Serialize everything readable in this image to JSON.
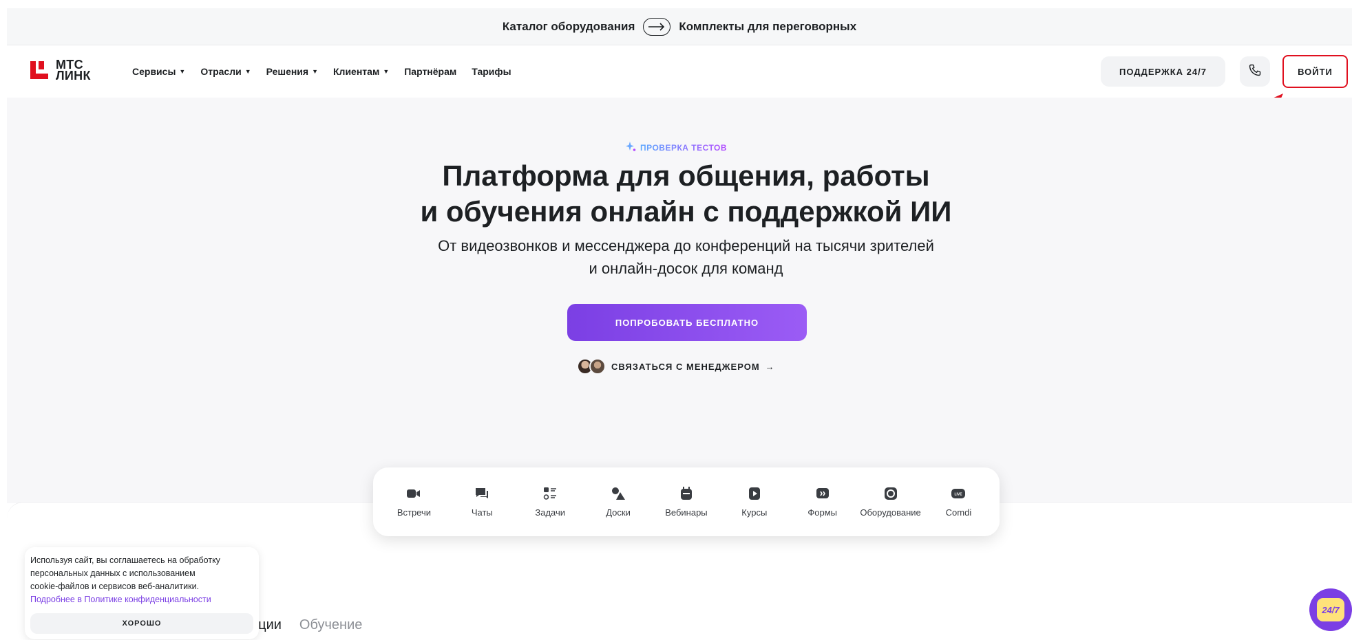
{
  "promo": {
    "left": "Каталог оборудования",
    "right": "Комплекты для переговорных"
  },
  "header": {
    "logo_line1": "МТС",
    "logo_line2": "ЛИНК",
    "nav": [
      {
        "label": "Сервисы",
        "dropdown": true
      },
      {
        "label": "Отрасли",
        "dropdown": true
      },
      {
        "label": "Решения",
        "dropdown": true
      },
      {
        "label": "Клиентам",
        "dropdown": true
      },
      {
        "label": "Партнёрам",
        "dropdown": false
      },
      {
        "label": "Тарифы",
        "dropdown": false
      }
    ],
    "support_label": "ПОДДЕРЖКА 24/7",
    "login_label": "ВОЙТИ"
  },
  "hero": {
    "tag": "ПРОВЕРКА ТЕСТОВ",
    "title_line1": "Платформа для общения, работы",
    "title_line2": "и обучения онлайн с поддержкой ИИ",
    "subtitle_line1": "От видеозвонков и мессенджера до конференций на тысячи зрителей",
    "subtitle_line2": "и онлайн-досок для команд",
    "cta_label": "ПОПРОБОВАТЬ БЕСПЛАТНО",
    "manager_label": "СВЯЗАТЬСЯ С МЕНЕДЖЕРОМ",
    "manager_arrow": "→"
  },
  "services": [
    {
      "label": "Встречи",
      "icon": "video-camera-icon"
    },
    {
      "label": "Чаты",
      "icon": "chat-icon"
    },
    {
      "label": "Задачи",
      "icon": "tasks-icon"
    },
    {
      "label": "Доски",
      "icon": "shapes-icon"
    },
    {
      "label": "Вебинары",
      "icon": "calendar-icon"
    },
    {
      "label": "Курсы",
      "icon": "play-icon"
    },
    {
      "label": "Формы",
      "icon": "quote-icon"
    },
    {
      "label": "Оборудование",
      "icon": "camera-lens-icon"
    },
    {
      "label": "Comdi",
      "icon": "live-icon"
    }
  ],
  "tabs": {
    "first_partial": "ации",
    "second": "Обучение"
  },
  "cookie": {
    "text_line1": "Используя сайт, вы соглашаетесь на обработку",
    "text_line2": "персональных данных с использованием",
    "text_line3": "cookie-файлов и сервисов веб-аналитики.",
    "link": "Подробнее в Политике конфиденциальности",
    "button": "ХОРОШО"
  },
  "chat_widget": {
    "label": "24/7"
  },
  "colors": {
    "brand_red": "#e0101f",
    "accent_purple": "#7b3fe4",
    "annotation_red": "#e0101f"
  }
}
